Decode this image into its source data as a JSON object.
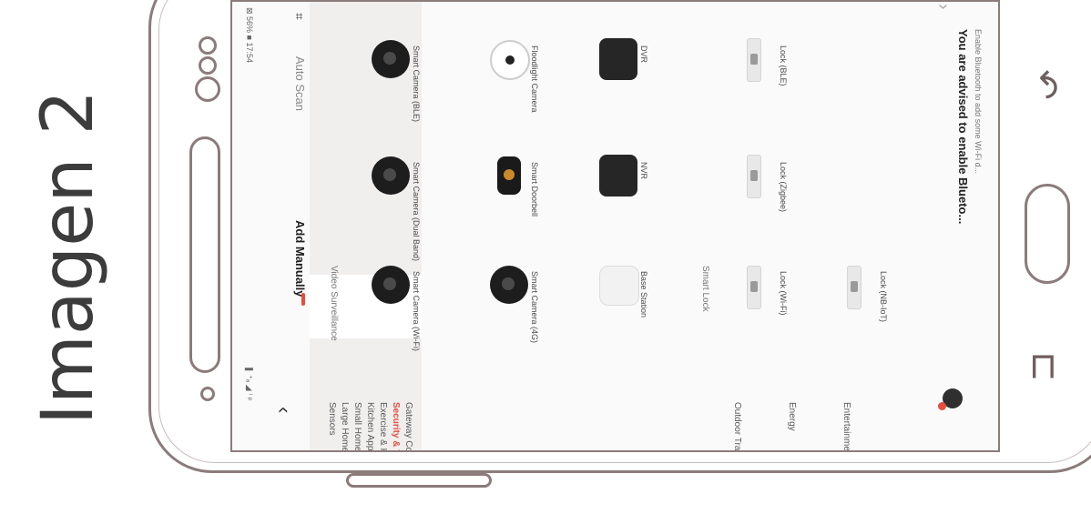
{
  "caption": "Imagen 2",
  "status_bar": {
    "left": "❚ ⁺ₐ ◢ ⁾ ᵖ",
    "right": "⊠ 56% ■ 17:54"
  },
  "header": {
    "back_icon": "chevron-left-icon",
    "tabs": [
      "Add Manually",
      "Auto Scan"
    ],
    "scan_icon": "scan-frame-icon",
    "accent_color": "#e74c3c"
  },
  "sidebar": {
    "items": [
      "Sensors",
      "Large Home Ap..",
      "Small Home Ap..",
      "Kitchen Appliances",
      "Exercise & Health",
      "Security & Video Sur..",
      "Gateway Control",
      "Outdoor Travel",
      "Energy",
      "Entertainment"
    ],
    "selected_index": 5
  },
  "sections": {
    "video_surveillance": {
      "title": "Video Surveillance",
      "devices": [
        {
          "name": "Smart Camera (Wi-Fi)"
        },
        {
          "name": "Smart Camera (Dual Band)"
        },
        {
          "name": "Smart Camera (BLE)"
        },
        {
          "name": "Smart Camera (4G)"
        },
        {
          "name": "Smart Doorbell"
        },
        {
          "name": "Floodlight Camera"
        },
        {
          "name": "Base Station"
        },
        {
          "name": "NVR"
        },
        {
          "name": "DVR"
        }
      ]
    },
    "smart_lock": {
      "title": "Smart Lock",
      "devices": [
        {
          "name": "Lock (Wi-Fi)"
        },
        {
          "name": "Lock (Zigbee)"
        },
        {
          "name": "Lock (BLE)"
        },
        {
          "name": "Lock (NB-IoT)"
        }
      ]
    }
  },
  "banner": {
    "title": "You are advised to enable Blueto...",
    "subtitle": "Enable Bluetooth to add some Wi-Fi d...",
    "chevron": "›"
  },
  "nav": {
    "back_glyph": "↶",
    "recent_glyph": "⊏"
  }
}
